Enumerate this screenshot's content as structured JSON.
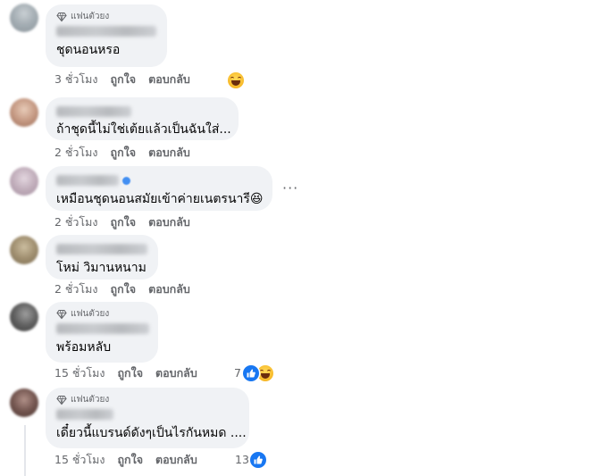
{
  "comments": [
    {
      "badge": "แฟนตัวยง",
      "text": "ชุดนอนหรอ",
      "time": "3 ชั่วโมง",
      "like": "ถูกใจ",
      "reply": "ตอบกลับ",
      "reaction_count": "",
      "reactions": [
        "laugh-emoji"
      ],
      "avatar_colors": [
        "#c9cfd3",
        "#8a949b"
      ]
    },
    {
      "badge": "",
      "text": "ถ้าชุดนี้ไม่ใช่เต้ยแล้วเป็นฉันใส่...",
      "time": "2 ชั่วโมง",
      "like": "ถูกใจ",
      "reply": "ตอบกลับ",
      "reaction_count": "",
      "reactions": [],
      "avatar_colors": [
        "#d9b6a0",
        "#9b6d58"
      ]
    },
    {
      "badge": "",
      "text": "เหมือนชุดนอนสมัยเข้าค่ายเนตรนารี😆",
      "time": "2 ชั่วโมง",
      "like": "ถูกใจ",
      "reply": "ตอบกลับ",
      "reaction_count": "",
      "reactions": [],
      "avatar_colors": [
        "#d8c8d4",
        "#a48fa0"
      ]
    },
    {
      "badge": "",
      "text": "โหม่ วิมานหนาม",
      "time": "2 ชั่วโมง",
      "like": "ถูกใจ",
      "reply": "ตอบกลับ",
      "reaction_count": "",
      "reactions": [],
      "avatar_colors": [
        "#b5a68a",
        "#7c6d52"
      ]
    },
    {
      "badge": "แฟนตัวยง",
      "text": "พร้อมหลับ",
      "time": "15 ชั่วโมง",
      "like": "ถูกใจ",
      "reply": "ตอบกลับ",
      "reaction_count": "7",
      "reactions": [
        "like-emoji",
        "laugh-emoji"
      ],
      "avatar_colors": [
        "#7d7d7d",
        "#3b3b3b"
      ]
    },
    {
      "badge": "แฟนตัวยง",
      "text": "เดี๋ยวนี้แบรนด์ดังๆเป็นไรกันหมด ....",
      "time": "15 ชั่วโมง",
      "like": "ถูกใจ",
      "reply": "ตอบกลับ",
      "reaction_count": "13",
      "reactions": [
        "like-emoji"
      ],
      "avatar_colors": [
        "#8c6f66",
        "#4a3530"
      ]
    }
  ],
  "icons": {
    "badge": "diamond-icon",
    "more": "more-options-icon",
    "verified": "verified-badge-icon"
  },
  "more_icon_glyph": "···",
  "colors": {
    "bubble": "#f0f2f5",
    "meta_text": "#65676b",
    "like_blue": "#1877f2",
    "laugh_yellow": "#f7b928"
  }
}
